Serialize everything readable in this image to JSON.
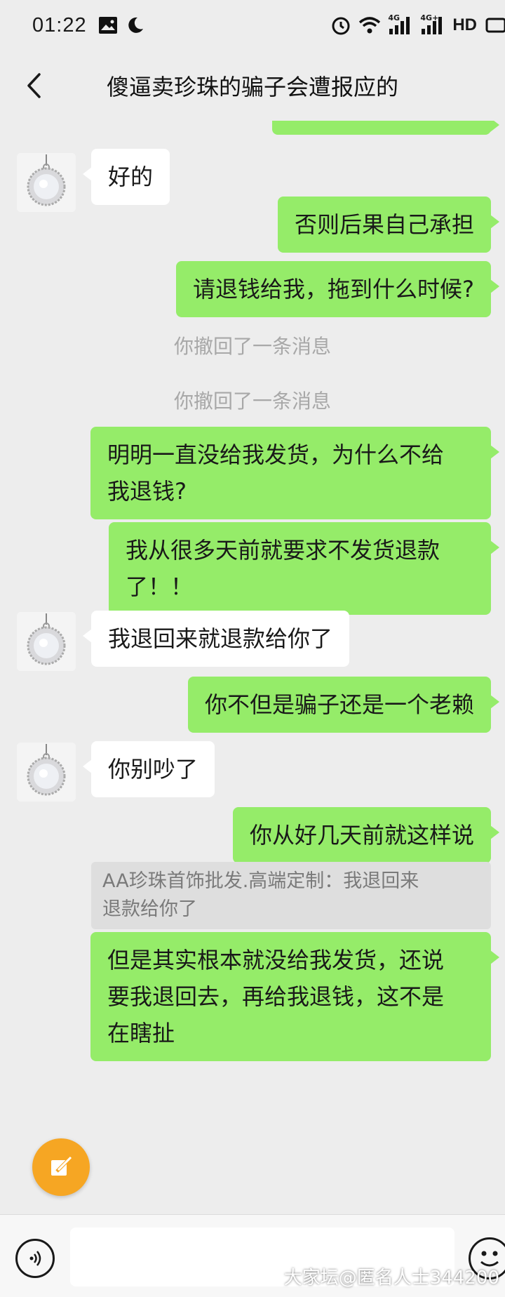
{
  "status_bar": {
    "time": "01:22",
    "network_1": "4G",
    "network_2": "4G+",
    "hd": "HD"
  },
  "header": {
    "title": "傻逼卖珍珠的骗子会遭报应的"
  },
  "messages": [
    {
      "side": "in",
      "text": "好的"
    },
    {
      "side": "out",
      "text": "否则后果自己承担"
    },
    {
      "side": "out",
      "text": "请退钱给我，拖到什么时候?"
    },
    {
      "type": "system",
      "text": "你撤回了一条消息"
    },
    {
      "type": "system",
      "text": "你撤回了一条消息"
    },
    {
      "side": "out",
      "lines": [
        "明明一直没给我发货，为什么不给",
        "我退钱?"
      ]
    },
    {
      "side": "out",
      "lines": [
        "我从很多天前就要求不发货退款",
        "了！！"
      ]
    },
    {
      "side": "in",
      "text": "我退回来就退款给你了"
    },
    {
      "side": "out",
      "text": "你不但是骗子还是一个老赖"
    },
    {
      "side": "in",
      "text": "你别吵了"
    },
    {
      "side": "out",
      "text": "你从好几天前就这样说"
    },
    {
      "type": "quote",
      "lines": [
        "AA珍珠首饰批发.高端定制：我退回来",
        "退款给你了"
      ]
    },
    {
      "side": "out",
      "lines": [
        "但是其实根本就没给我发货，还说",
        "要我退回去，再给我退钱，这不是",
        "在瞎扯"
      ]
    }
  ],
  "input": {
    "value": "",
    "placeholder": ""
  },
  "watermark": "大家坛@匿名人士344200",
  "colors": {
    "background": "#ededed",
    "outgoing_bubble": "#95ec69",
    "incoming_bubble": "#ffffff",
    "fab": "#f6a623"
  }
}
